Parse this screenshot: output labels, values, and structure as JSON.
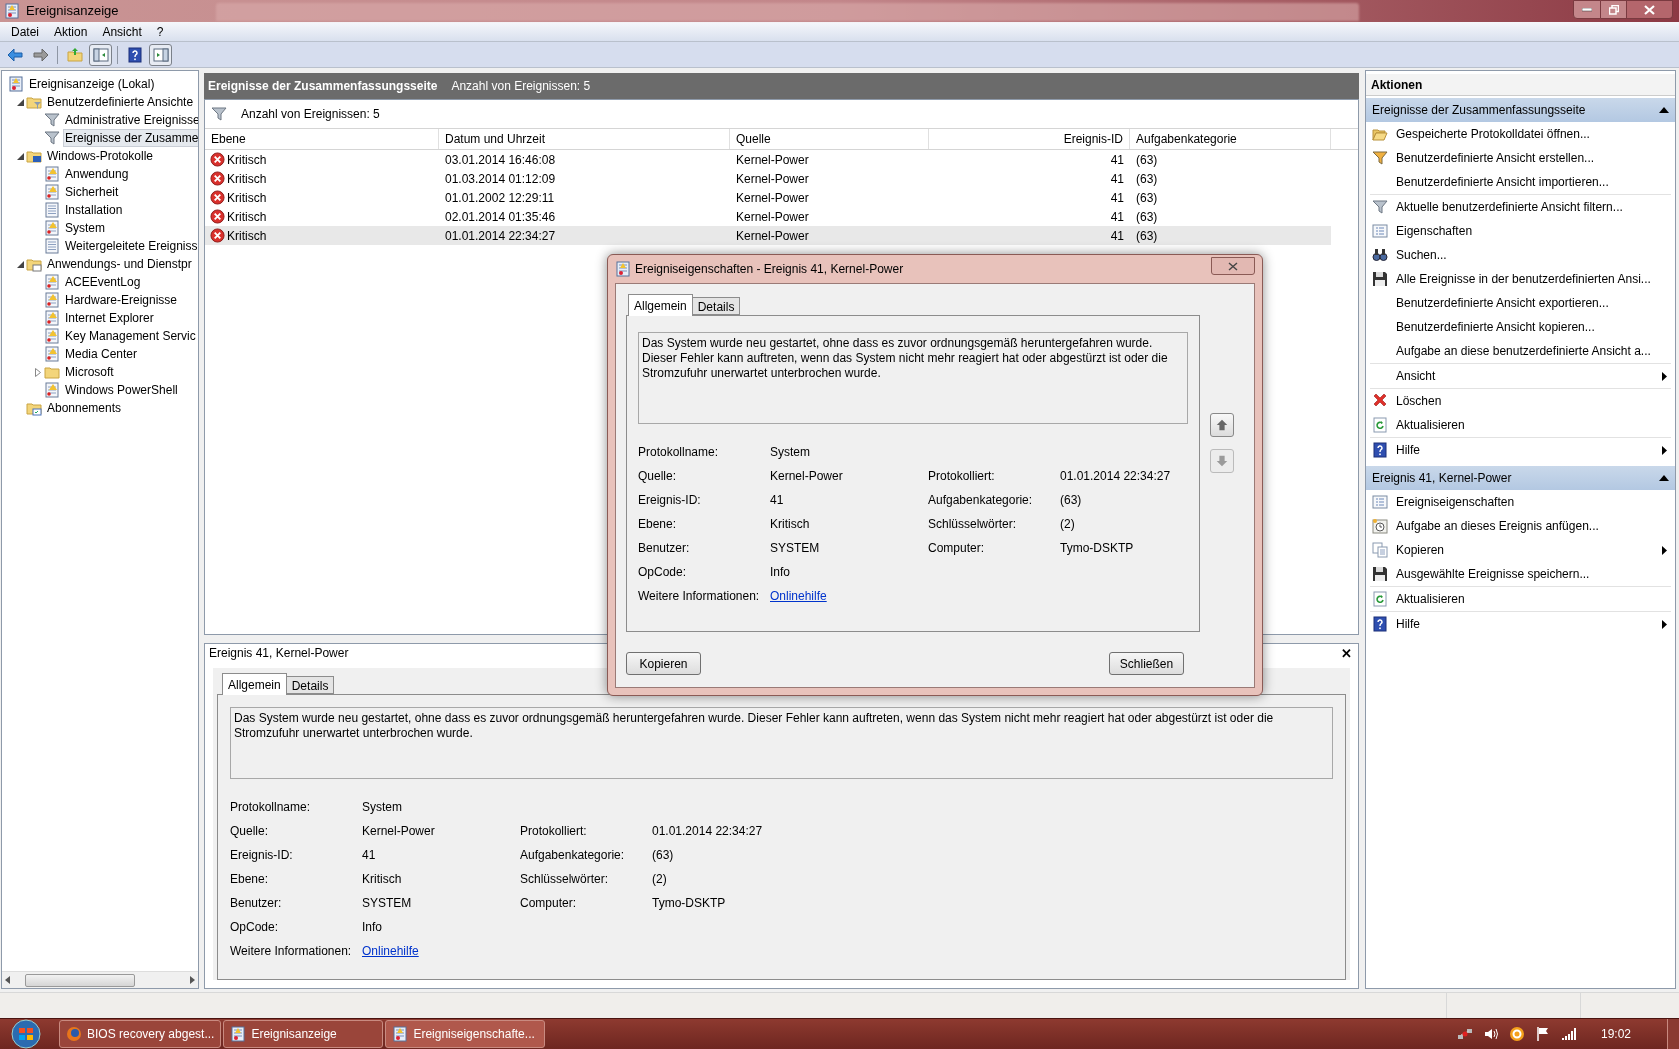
{
  "window": {
    "title": "Ereignisanzeige"
  },
  "menu": [
    "Datei",
    "Aktion",
    "Ansicht",
    "?"
  ],
  "toolbar": [
    {
      "kind": "back",
      "pressed": false
    },
    {
      "kind": "forward",
      "pressed": false
    },
    {
      "kind": "folder-up",
      "pressed": false
    },
    {
      "kind": "tree-pane",
      "pressed": true
    },
    {
      "kind": "help",
      "pressed": false
    },
    {
      "kind": "action-pane",
      "pressed": true
    }
  ],
  "tree": [
    {
      "label": "Ereignisanzeige (Lokal)",
      "kind": "root",
      "selected": false,
      "children": [
        {
          "label": "Benutzerdefinierte Ansichte",
          "kind": "folder-filter",
          "expanded": true,
          "selected": false,
          "children": [
            {
              "label": "Administrative Ereignisse",
              "kind": "filter",
              "selected": false
            },
            {
              "label": "Ereignisse der Zusamme",
              "kind": "filter",
              "selected": true
            }
          ]
        },
        {
          "label": "Windows-Protokolle",
          "kind": "folder-computer",
          "expanded": true,
          "selected": false,
          "children": [
            {
              "label": "Anwendung",
              "kind": "log-warn",
              "selected": false
            },
            {
              "label": "Sicherheit",
              "kind": "log-warn",
              "selected": false
            },
            {
              "label": "Installation",
              "kind": "log",
              "selected": false
            },
            {
              "label": "System",
              "kind": "log-warn",
              "selected": false
            },
            {
              "label": "Weitergeleitete Ereigniss",
              "kind": "log",
              "selected": false
            }
          ]
        },
        {
          "label": "Anwendungs- und Dienstpr",
          "kind": "folder-app",
          "expanded": true,
          "selected": false,
          "children": [
            {
              "label": "ACEEventLog",
              "kind": "log-warn",
              "selected": false
            },
            {
              "label": "Hardware-Ereignisse",
              "kind": "log-warn",
              "selected": false
            },
            {
              "label": "Internet Explorer",
              "kind": "log-warn",
              "selected": false
            },
            {
              "label": "Key Management Servic",
              "kind": "log-warn",
              "selected": false
            },
            {
              "label": "Media Center",
              "kind": "log-warn",
              "selected": false
            },
            {
              "label": "Microsoft",
              "kind": "folder",
              "expanded": false,
              "selected": false
            },
            {
              "label": "Windows PowerShell",
              "kind": "log-warn",
              "selected": false
            }
          ]
        },
        {
          "label": "Abonnements",
          "kind": "subscriptions",
          "selected": false
        }
      ]
    }
  ],
  "center": {
    "title": "Ereignisse der Zusammenfassungsseite",
    "subtitle": "Anzahl von Ereignissen: 5",
    "filter_text": "Anzahl von Ereignissen: 5",
    "columns": [
      "Ebene",
      "Datum und Uhrzeit",
      "Quelle",
      "Ereignis-ID",
      "Aufgabenkategorie"
    ],
    "rows": [
      {
        "level": "Kritisch",
        "date": "03.01.2014 16:46:08",
        "source": "Kernel-Power",
        "id": "41",
        "category": "(63)",
        "selected": false
      },
      {
        "level": "Kritisch",
        "date": "01.03.2014 01:12:09",
        "source": "Kernel-Power",
        "id": "41",
        "category": "(63)",
        "selected": false
      },
      {
        "level": "Kritisch",
        "date": "01.01.2002 12:29:11",
        "source": "Kernel-Power",
        "id": "41",
        "category": "(63)",
        "selected": false
      },
      {
        "level": "Kritisch",
        "date": "02.01.2014 01:35:46",
        "source": "Kernel-Power",
        "id": "41",
        "category": "(63)",
        "selected": false
      },
      {
        "level": "Kritisch",
        "date": "01.01.2014 22:34:27",
        "source": "Kernel-Power",
        "id": "41",
        "category": "(63)",
        "selected": true
      }
    ]
  },
  "preview": {
    "title": "Ereignis 41, Kernel-Power",
    "close": "✕",
    "tabs": [
      {
        "label": "Allgemein",
        "selected": true
      },
      {
        "label": "Details",
        "selected": false
      }
    ],
    "description": "Das System wurde neu gestartet, ohne dass es zuvor ordnungsgemäß heruntergefahren wurde. Dieser Fehler kann auftreten, wenn das System nicht mehr reagiert hat oder abgestürzt ist oder die Stromzufuhr unerwartet unterbrochen wurde.",
    "fields": [
      [
        {
          "label": "Protokollname:",
          "value": "System",
          "kind": "text"
        }
      ],
      [
        {
          "label": "Quelle:",
          "value": "Kernel-Power",
          "kind": "text"
        },
        {
          "label": "Protokolliert:",
          "value": "01.01.2014 22:34:27",
          "kind": "text"
        }
      ],
      [
        {
          "label": "Ereignis-ID:",
          "value": "41",
          "kind": "text"
        },
        {
          "label": "Aufgabenkategorie:",
          "value": "(63)",
          "kind": "text"
        }
      ],
      [
        {
          "label": "Ebene:",
          "value": "Kritisch",
          "kind": "text"
        },
        {
          "label": "Schlüsselwörter:",
          "value": "(2)",
          "kind": "text"
        }
      ],
      [
        {
          "label": "Benutzer:",
          "value": "SYSTEM",
          "kind": "text"
        },
        {
          "label": "Computer:",
          "value": "Tymo-DSKTP",
          "kind": "text"
        }
      ],
      [
        {
          "label": "OpCode:",
          "value": "Info",
          "kind": "text"
        }
      ],
      [
        {
          "label": "Weitere Informationen:",
          "value": "Onlinehilfe",
          "kind": "link"
        }
      ]
    ]
  },
  "dialog": {
    "title": "Ereigniseigenschaften - Ereignis 41, Kernel-Power",
    "tabs": [
      {
        "label": "Allgemein",
        "selected": true
      },
      {
        "label": "Details",
        "selected": false
      }
    ],
    "description": "Das System wurde neu gestartet, ohne dass es zuvor ordnungsgemäß heruntergefahren wurde. Dieser Fehler kann auftreten, wenn das System nicht mehr reagiert hat oder abgestürzt ist oder die Stromzufuhr unerwartet unterbrochen wurde.",
    "fields": [
      [
        {
          "label": "Protokollname:",
          "value": "System",
          "kind": "text"
        }
      ],
      [
        {
          "label": "Quelle:",
          "value": "Kernel-Power",
          "kind": "text"
        },
        {
          "label": "Protokolliert:",
          "value": "01.01.2014 22:34:27",
          "kind": "text"
        }
      ],
      [
        {
          "label": "Ereignis-ID:",
          "value": "41",
          "kind": "text"
        },
        {
          "label": "Aufgabenkategorie:",
          "value": "(63)",
          "kind": "text"
        }
      ],
      [
        {
          "label": "Ebene:",
          "value": "Kritisch",
          "kind": "text"
        },
        {
          "label": "Schlüsselwörter:",
          "value": "(2)",
          "kind": "text"
        }
      ],
      [
        {
          "label": "Benutzer:",
          "value": "SYSTEM",
          "kind": "text"
        },
        {
          "label": "Computer:",
          "value": "Tymo-DSKTP",
          "kind": "text"
        }
      ],
      [
        {
          "label": "OpCode:",
          "value": "Info",
          "kind": "text"
        }
      ],
      [
        {
          "label": "Weitere Informationen:",
          "value": "Onlinehilfe",
          "kind": "link"
        }
      ]
    ],
    "buttons": [
      "Kopieren",
      "Schließen"
    ]
  },
  "actions": {
    "title": "Aktionen",
    "sections": [
      {
        "title": "Ereignisse der Zusammenfassungsseite",
        "expanded": true,
        "groups": [
          [
            {
              "label": "Gespeicherte Protokolldatei öffnen...",
              "kind": "open-folder",
              "submenu": false
            },
            {
              "label": "Benutzerdefinierte Ansicht erstellen...",
              "kind": "funnel-star",
              "submenu": false
            },
            {
              "label": "Benutzerdefinierte Ansicht importieren...",
              "kind": "none",
              "submenu": false
            }
          ],
          [
            {
              "label": "Aktuelle benutzerdefinierte Ansicht filtern...",
              "kind": "funnel",
              "submenu": false
            },
            {
              "label": "Eigenschaften",
              "kind": "properties",
              "submenu": false
            },
            {
              "label": "Suchen...",
              "kind": "binoculars",
              "submenu": false
            },
            {
              "label": "Alle Ereignisse in der benutzerdefinierten Ansi...",
              "kind": "floppy",
              "submenu": false
            },
            {
              "label": "Benutzerdefinierte Ansicht exportieren...",
              "kind": "none",
              "submenu": false
            },
            {
              "label": "Benutzerdefinierte Ansicht kopieren...",
              "kind": "none",
              "submenu": false
            },
            {
              "label": "Aufgabe an diese benutzerdefinierte Ansicht a...",
              "kind": "none",
              "submenu": false
            }
          ],
          [
            {
              "label": "Ansicht",
              "kind": "none",
              "submenu": true
            }
          ],
          [
            {
              "label": "Löschen",
              "kind": "delete",
              "submenu": false
            },
            {
              "label": "Aktualisieren",
              "kind": "refresh",
              "submenu": false
            }
          ],
          [
            {
              "label": "Hilfe",
              "kind": "help",
              "submenu": true
            }
          ]
        ]
      },
      {
        "title": "Ereignis 41, Kernel-Power",
        "expanded": true,
        "groups": [
          [
            {
              "label": "Ereigniseigenschaften",
              "kind": "properties",
              "submenu": false
            },
            {
              "label": "Aufgabe an dieses Ereignis anfügen...",
              "kind": "task-clock",
              "submenu": false
            },
            {
              "label": "Kopieren",
              "kind": "copy",
              "submenu": true
            },
            {
              "label": "Ausgewählte Ereignisse speichern...",
              "kind": "floppy",
              "submenu": false
            }
          ],
          [
            {
              "label": "Aktualisieren",
              "kind": "refresh",
              "submenu": false
            }
          ],
          [
            {
              "label": "Hilfe",
              "kind": "help",
              "submenu": true
            }
          ]
        ]
      }
    ]
  },
  "taskbar": {
    "buttons": [
      {
        "label": "BIOS recovery abgest...",
        "kind": "browser",
        "selected": false
      },
      {
        "label": "Ereignisanzeige",
        "kind": "app",
        "selected": false
      },
      {
        "label": "Ereigniseigenschafte...",
        "kind": "app",
        "selected": true
      }
    ],
    "tray": [
      {
        "kind": "network"
      },
      {
        "kind": "speaker"
      },
      {
        "kind": "tray-app"
      },
      {
        "kind": "flag"
      },
      {
        "kind": "signal"
      }
    ],
    "clock": "19:02"
  }
}
